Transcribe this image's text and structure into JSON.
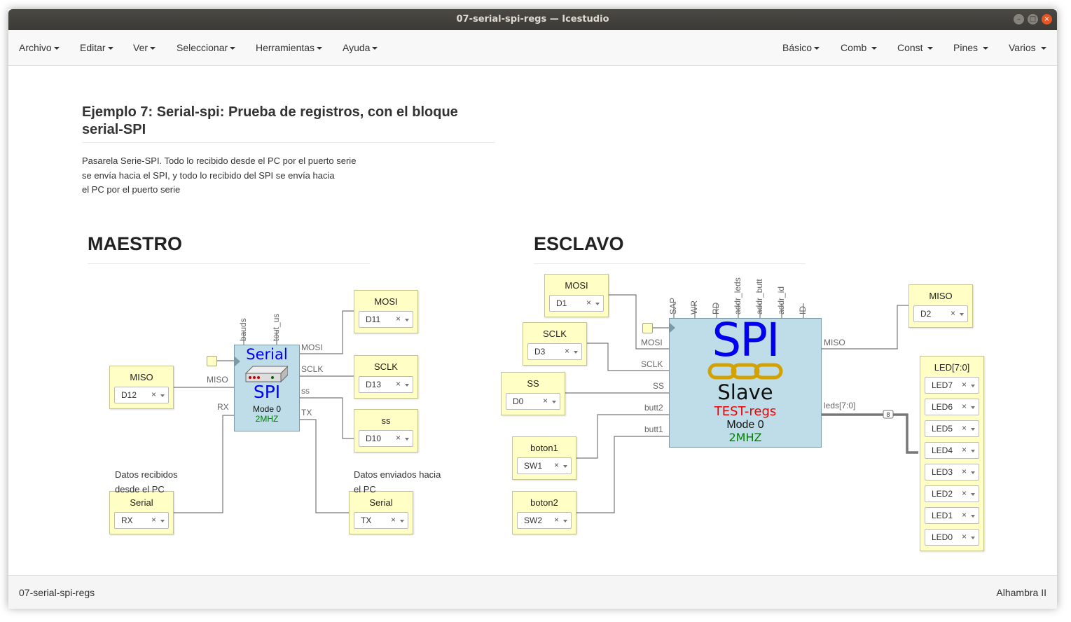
{
  "window": {
    "title": "07-serial-spi-regs — Icestudio",
    "controls": [
      "–",
      "□",
      "×"
    ]
  },
  "menu_left": [
    "Archivo",
    "Editar",
    "Ver",
    "Seleccionar",
    "Herramientas",
    "Ayuda"
  ],
  "menu_right": [
    "Básico",
    "Comb",
    "Const",
    "Pines",
    "Varios"
  ],
  "doc": {
    "heading_line1": "Ejemplo 7: Serial-spi: Prueba de registros, con el bloque",
    "heading_line2": "serial-SPI",
    "desc_line1": "Pasarela Serie-SPI. Todo lo recibido desde el PC por el puerto serie",
    "desc_line2": "se envía hacia el SPI, y todo lo recibido del SPI se envía hacia",
    "desc_line3": "el PC por el puerto serie"
  },
  "maestro": {
    "title": "MAESTRO",
    "note_rx_line1": "Datos recibidos",
    "note_rx_line2": "desde el PC",
    "note_tx_line1": "Datos enviados hacia",
    "note_tx_line2": "el PC",
    "pins": {
      "mosi": {
        "name": "MOSI",
        "value": "D11"
      },
      "sclk": {
        "name": "SCLK",
        "value": "D13"
      },
      "ss": {
        "name": "ss",
        "value": "D10"
      },
      "miso": {
        "name": "MISO",
        "value": "D12"
      },
      "serial_rx": {
        "name": "Serial",
        "value": "RX"
      },
      "serial_tx": {
        "name": "Serial",
        "value": "TX"
      }
    },
    "module": {
      "title": "Serial",
      "subtitle": "SPI",
      "mode": "Mode 0",
      "freq": "2MHZ",
      "params": [
        "bauds",
        "tout_us"
      ],
      "inputs": [
        "MISO",
        "RX"
      ],
      "outputs": [
        "MOSI",
        "SCLK",
        "ss",
        "TX"
      ]
    }
  },
  "esclavo": {
    "title": "ESCLAVO",
    "pins": {
      "mosi": {
        "name": "MOSI",
        "value": "D1"
      },
      "sclk": {
        "name": "SCLK",
        "value": "D3"
      },
      "ss": {
        "name": "SS",
        "value": "D0"
      },
      "boton1": {
        "name": "boton1",
        "value": "SW1"
      },
      "boton2": {
        "name": "boton2",
        "value": "SW2"
      },
      "miso": {
        "name": "MISO",
        "value": "D2"
      }
    },
    "led_block": {
      "name": "LED[7:0]",
      "values": [
        "LED7",
        "LED6",
        "LED5",
        "LED4",
        "LED3",
        "LED2",
        "LED1",
        "LED0"
      ]
    },
    "module": {
      "title": "SPI",
      "subtitle": "Slave",
      "tag": "TEST-regs",
      "mode": "Mode 0",
      "freq": "2MHZ",
      "params": [
        "SAP",
        "WR",
        "RD",
        "addr_leds",
        "addr_butt",
        "addr_id",
        "ID"
      ],
      "inputs": [
        "MOSI",
        "SCLK",
        "SS",
        "butt2",
        "butt1"
      ],
      "outputs": [
        "MISO",
        "leds[7:0]"
      ],
      "bus_width": "8"
    }
  },
  "status": {
    "left": "07-serial-spi-regs",
    "right": "Alhambra II"
  },
  "colors": {
    "pin_block": "#fffec4",
    "module": "#bfdde8",
    "accent_blue": "#0000ee",
    "accent_red": "#ee0000",
    "accent_green": "#008000",
    "chain_gold": "#d4a200"
  }
}
